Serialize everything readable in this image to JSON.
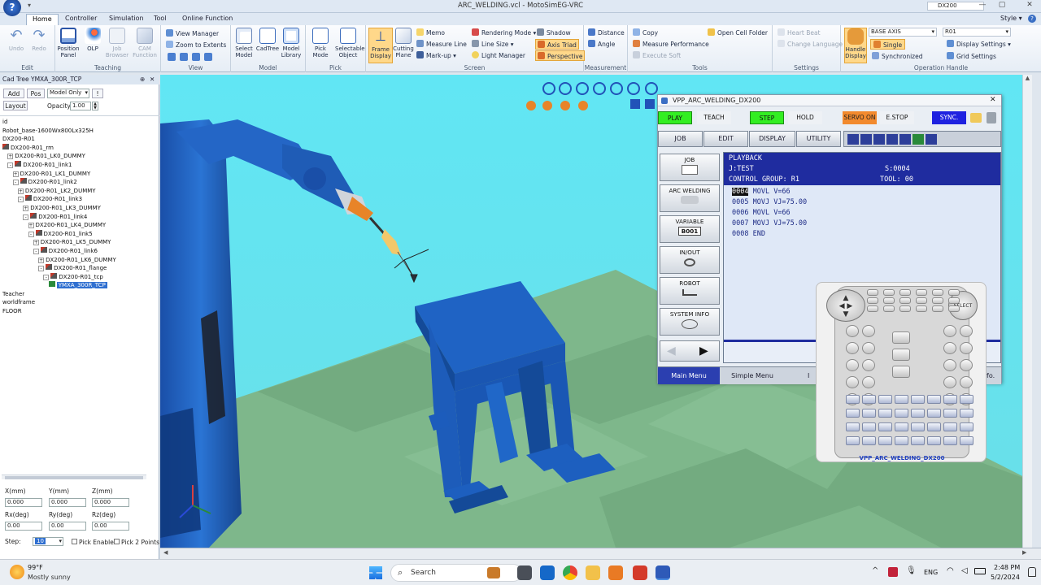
{
  "window": {
    "title": "ARC_WELDING.vcl - MotoSimEG-VRC",
    "style_label": "Style",
    "robot_combo": "DX200"
  },
  "tabs": [
    "Home",
    "Controller",
    "Simulation",
    "Tool",
    "Online Function"
  ],
  "ribbon": {
    "edit": {
      "label": "Edit",
      "undo": "Undo",
      "redo": "Redo"
    },
    "teaching": {
      "label": "Teaching",
      "position_panel": "Position Panel",
      "olp": "OLP",
      "job_browser": "Job Browser",
      "cam_function": "CAM Function"
    },
    "view": {
      "label": "View",
      "view_manager": "View Manager",
      "zoom_extents": "Zoom to Extents"
    },
    "model": {
      "label": "Model",
      "select_model": "Select Model",
      "cadtree": "CadTree",
      "model_library": "Model Library"
    },
    "pick": {
      "label": "Pick",
      "pick_mode": "Pick Mode",
      "selectable_object": "Selectable Object"
    },
    "screen": {
      "label": "Screen",
      "frame_display": "Frame Display",
      "cutting_plane": "Cutting Plane",
      "memo": "Memo",
      "measure_line": "Measure Line",
      "markup": "Mark-up",
      "rendering_mode": "Rendering Mode",
      "line_size": "Line Size",
      "light_manager": "Light Manager",
      "shadow": "Shadow",
      "axis_triad": "Axis Triad",
      "perspective": "Perspective"
    },
    "measurement": {
      "label": "Measurement",
      "distance": "Distance",
      "angle": "Angle"
    },
    "tools": {
      "label": "Tools",
      "copy": "Copy",
      "measure_performance": "Measure Performance",
      "execute_soft": "Execute Soft",
      "open_cell_folder": "Open Cell Folder"
    },
    "settings": {
      "label": "Settings",
      "heart_beat": "Heart Beat",
      "change_language": "Change Language"
    },
    "operation_handle": {
      "label": "Operation Handle",
      "handle_display": "Handle Display",
      "base_axis": "BASE AXIS",
      "r01": "R01",
      "single": "Single",
      "synchronized": "Synchronized",
      "display_settings": "Display Settings",
      "grid_settings": "Grid Settings"
    }
  },
  "tree": {
    "header": "Cad Tree YMXA_300R_TCP",
    "add": "Add",
    "pos": "Pos",
    "mode": "Model Only",
    "opacity_label": "Opacity:",
    "opacity": "1.00",
    "layout": "Layout",
    "items": [
      {
        "text": "id",
        "ex": "",
        "robot": false
      },
      {
        "text": "Robot_base-1600Wx800Lx325H",
        "ex": "",
        "robot": false
      },
      {
        "text": "DX200-R01",
        "ex": "",
        "robot": false
      },
      {
        "text": "DX200-R01_rm",
        "ex": "",
        "robot": true
      },
      {
        "text": "DX200-R01_LK0_DUMMY",
        "ex": "+",
        "robot": false
      },
      {
        "text": "DX200-R01_link1",
        "ex": "-",
        "robot": true
      },
      {
        "text": "DX200-R01_LK1_DUMMY",
        "ex": "+",
        "robot": false
      },
      {
        "text": "DX200-R01_link2",
        "ex": "-",
        "robot": true
      },
      {
        "text": "DX200-R01_LK2_DUMMY",
        "ex": "+",
        "robot": false
      },
      {
        "text": "DX200-R01_link3",
        "ex": "-",
        "robot": true
      },
      {
        "text": "DX200-R01_LK3_DUMMY",
        "ex": "+",
        "robot": false
      },
      {
        "text": "DX200-R01_link4",
        "ex": "-",
        "robot": true
      },
      {
        "text": "DX200-R01_LK4_DUMMY",
        "ex": "+",
        "robot": false
      },
      {
        "text": "DX200-R01_link5",
        "ex": "-",
        "robot": true
      },
      {
        "text": "DX200-R01_LK5_DUMMY",
        "ex": "+",
        "robot": false
      },
      {
        "text": "DX200-R01_link6",
        "ex": "-",
        "robot": true
      },
      {
        "text": "DX200-R01_LK6_DUMMY",
        "ex": "+",
        "robot": false
      },
      {
        "text": "DX200-R01_flange",
        "ex": "-",
        "robot": true
      },
      {
        "text": "DX200-R01_tcp",
        "ex": "-",
        "robot": true
      },
      {
        "text": "YMXA_300R_TCP",
        "ex": "",
        "robot": false
      },
      {
        "text": "Teacher",
        "ex": "",
        "robot": false
      },
      {
        "text": "worldframe",
        "ex": "",
        "robot": false
      },
      {
        "text": "FLOOR",
        "ex": "",
        "robot": false
      }
    ],
    "coords": {
      "x_label": "X(mm)",
      "y_label": "Y(mm)",
      "z_label": "Z(mm)",
      "rx_label": "Rx(deg)",
      "ry_label": "Ry(deg)",
      "rz_label": "Rz(deg)",
      "x": "0.000",
      "y": "0.000",
      "z": "0.000",
      "rx": "0.00",
      "ry": "0.00",
      "rz": "0.00",
      "step_label": "Step:",
      "step": "10",
      "pick_enable": "Pick Enable",
      "pick_2_points": "Pick 2 Points"
    }
  },
  "pendant": {
    "title": "VPP_ARC_WELDING_DX200",
    "top_buttons": {
      "play": "PLAY",
      "teach": "TEACH",
      "step": "STEP",
      "hold": "HOLD",
      "servo_on": "SERVO ON",
      "estop": "E.STOP",
      "sync": "SYNC."
    },
    "menu": {
      "job": "JOB",
      "edit": "EDIT",
      "display": "DISPLAY",
      "utility": "UTILITY"
    },
    "side": {
      "job": "JOB",
      "arc_welding": "ARC WELDING",
      "variable": "VARIABLE",
      "b001": "B001",
      "inout": "IN/OUT",
      "robot": "ROBOT",
      "system_info": "SYSTEM INFO"
    },
    "screen": {
      "mode": "PLAYBACK",
      "job": "J:TEST",
      "step": "S:0004",
      "control_group": "CONTROL GROUP: R1",
      "tool": "TOOL: 00"
    },
    "job_lines": [
      {
        "num": "0004",
        "text": " MOVL V=66",
        "cursor": true
      },
      {
        "num": "0005",
        "text": " MOVJ VJ=75.00",
        "cursor": false
      },
      {
        "num": "0006",
        "text": " MOVL V=66",
        "cursor": false
      },
      {
        "num": "0007",
        "text": " MOVJ VJ=75.00",
        "cursor": false
      },
      {
        "num": "0008",
        "text": " END",
        "cursor": false
      }
    ],
    "bottom": {
      "main_menu": "Main Menu",
      "simple_menu": "Simple Menu",
      "i": "I",
      "fo": "fo."
    }
  },
  "device": {
    "label": "VPP_ARC_WELDING_DX200",
    "select": "SELECT"
  },
  "taskbar": {
    "temp": "99°F",
    "weather": "Mostly sunny",
    "search": "Search",
    "lang": "ENG",
    "time": "2:48 PM",
    "date": "5/2/2024"
  },
  "colors": {
    "play": "#33ee22",
    "step": "#33ee22",
    "servo": "#f28a2e",
    "sync": "#1f22e0",
    "pendant_screen": "#dfe8f7",
    "pendant_header": "#1f2c9f",
    "main_menu": "#2b3fb0",
    "floor": "#7db58a",
    "robot_blue": "#2466c6",
    "sky": "#58e0f0"
  }
}
